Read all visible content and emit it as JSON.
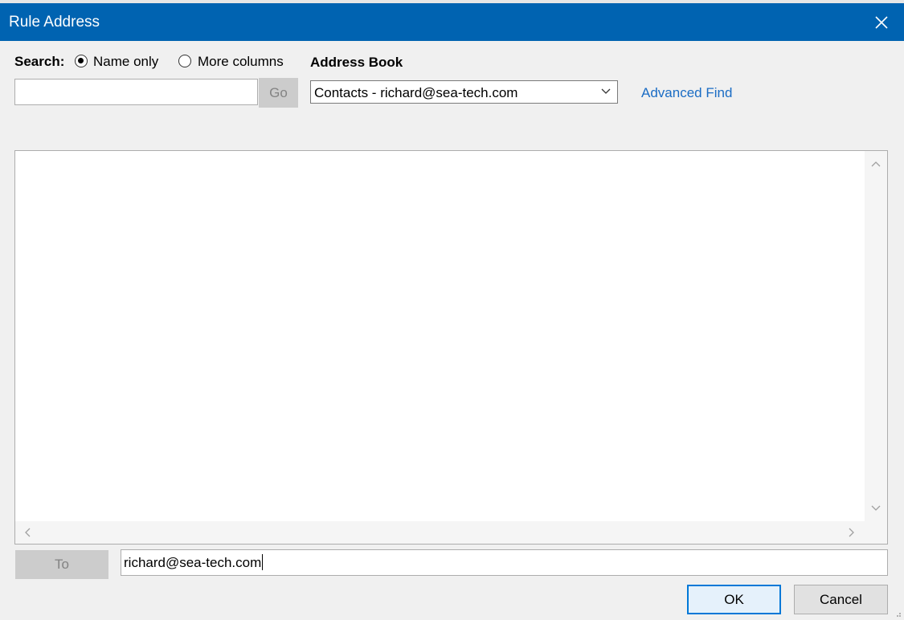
{
  "window": {
    "title": "Rule Address",
    "accent_color": "#0063b1",
    "close_icon": "close-icon"
  },
  "search": {
    "label": "Search:",
    "options": [
      {
        "label": "Name only",
        "selected": true
      },
      {
        "label": "More columns",
        "selected": false
      }
    ],
    "input_value": "",
    "go_label": "Go"
  },
  "address_book": {
    "label": "Address Book",
    "selected": "Contacts - richard@sea-tech.com",
    "advanced_find": "Advanced Find"
  },
  "results": {
    "rows": []
  },
  "recipient": {
    "to_label": "To",
    "value": "richard@sea-tech.com"
  },
  "footer": {
    "ok_label": "OK",
    "cancel_label": "Cancel"
  }
}
